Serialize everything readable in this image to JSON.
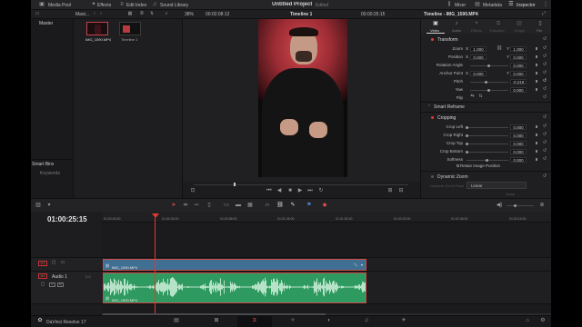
{
  "toolbar": {
    "media_pool": "Media Pool",
    "effects": "Effects",
    "edit_index": "Edit Index",
    "sound_library": "Sound Library",
    "project_title": "Untitled Project",
    "project_status": "Edited",
    "mixer": "Mixer",
    "metadata": "Metadata",
    "inspector": "Inspector"
  },
  "subbar": {
    "bin_label": "Mast...",
    "zoom": "38%",
    "source_tc": "00:02:08:12",
    "timeline_name": "Timeline 1",
    "record_tc": "00:00:25:15",
    "inspector_title": "Timeline - IMG_1590.MP4"
  },
  "media_pool": {
    "bin_master": "Master",
    "clips": [
      {
        "name": "IMG_1590.MP4"
      },
      {
        "name": "Timeline 1"
      }
    ],
    "smart_bins": "Smart Bins",
    "keywords": "Keywords"
  },
  "inspector": {
    "tabs": [
      "Video",
      "Audio",
      "Effects",
      "Transition",
      "Image",
      "File"
    ],
    "transform": {
      "header": "Transform",
      "rows": [
        {
          "label": "Zoom",
          "a": "X",
          "v1": "1.000",
          "b": "Y",
          "v2": "1.000"
        },
        {
          "label": "Position",
          "a": "X",
          "v1": "0.000",
          "b": "Y",
          "v2": "0.000"
        },
        {
          "label": "Rotation Angle",
          "v2": "0.000"
        },
        {
          "label": "Anchor Point",
          "a": "X",
          "v1": "0.000",
          "b": "Y",
          "v2": "0.000"
        },
        {
          "label": "Pitch",
          "v2": "-0.218"
        },
        {
          "label": "Yaw",
          "v2": "0.000"
        },
        {
          "label": "Flip"
        }
      ]
    },
    "smart_reframe": "Smart Reframe",
    "cropping": {
      "header": "Cropping",
      "rows": [
        {
          "label": "Crop Left",
          "v2": "0.000"
        },
        {
          "label": "Crop Right",
          "v2": "0.000"
        },
        {
          "label": "Crop Top",
          "v2": "0.000"
        },
        {
          "label": "Crop Bottom",
          "v2": "0.000"
        },
        {
          "label": "Softness",
          "v2": "0.000"
        }
      ],
      "retain": "Retain Image Position"
    },
    "dynamic_zoom": {
      "header": "Dynamic Zoom",
      "ease_label": "Dynamic Zoom Ease",
      "ease_value": "Linear",
      "swap": "Swap"
    }
  },
  "timeline": {
    "timecode": "01:00:25:15",
    "ruler": [
      "01:00:00:00",
      "01:00:26:00",
      "01:00:58:00",
      "01:01:26:00",
      "01:01:52:00",
      "01:02:20:00",
      "01:02:48:00",
      "01:03:16:00"
    ],
    "video_track": {
      "id": "V1",
      "clip": "IMG_1590.MP4"
    },
    "audio_track": {
      "id": "A1",
      "name": "Audio 1",
      "level": "2.0",
      "clip": "IMG_1590.MP4"
    }
  },
  "app": {
    "name": "DaVinci Resolve 17"
  },
  "colors": {
    "accent_red": "#e03c3c",
    "video_clip": "#3f6f92",
    "audio_clip": "#2f9a5f",
    "playhead": "#e33a2f"
  }
}
